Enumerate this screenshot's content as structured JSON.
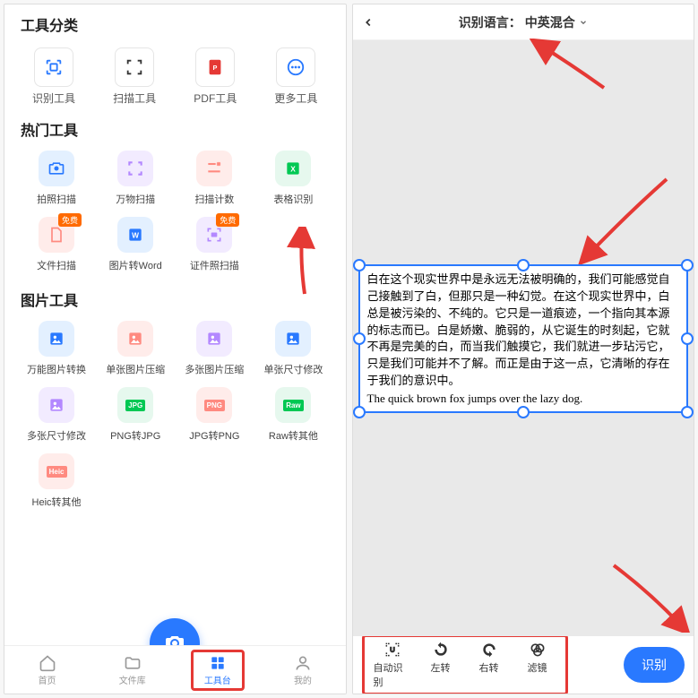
{
  "left": {
    "sections": {
      "categories_title": "工具分类",
      "hot_title": "热门工具",
      "img_title": "图片工具"
    },
    "categories": [
      {
        "label": "识别工具",
        "icon": "scan-frame"
      },
      {
        "label": "扫描工具",
        "icon": "scan-corners"
      },
      {
        "label": "PDF工具",
        "icon": "pdf"
      },
      {
        "label": "更多工具",
        "icon": "more"
      }
    ],
    "hot_tools": [
      {
        "label": "拍照扫描",
        "color": "#2979ff",
        "icon": "camera"
      },
      {
        "label": "万物扫描",
        "color": "#b388ff",
        "icon": "scan"
      },
      {
        "label": "扫描计数",
        "color": "#ff8a80",
        "icon": "count"
      },
      {
        "label": "表格识别",
        "color": "#00c853",
        "icon": "excel"
      },
      {
        "label": "文件扫描",
        "color": "#ff8a80",
        "icon": "file",
        "badge": "免费"
      },
      {
        "label": "图片转Word",
        "color": "#2979ff",
        "icon": "word"
      },
      {
        "label": "证件照扫描",
        "color": "#b388ff",
        "icon": "idcard",
        "badge": "免费"
      }
    ],
    "img_tools": [
      {
        "label": "万能图片转换",
        "color": "#2979ff"
      },
      {
        "label": "单张图片压缩",
        "color": "#ff8a80"
      },
      {
        "label": "多张图片压缩",
        "color": "#b388ff"
      },
      {
        "label": "单张尺寸修改",
        "color": "#2979ff"
      },
      {
        "label": "多张尺寸修改",
        "color": "#b388ff"
      },
      {
        "label": "PNG转JPG",
        "color": "#00c853",
        "tag": "JPG"
      },
      {
        "label": "JPG转PNG",
        "color": "#ff8a80",
        "tag": "PNG"
      },
      {
        "label": "Raw转其他",
        "color": "#00c853",
        "tag": "Raw"
      },
      {
        "label": "Heic转其他",
        "color": "#ff8a80",
        "tag": "Heic"
      }
    ],
    "navbar": [
      {
        "label": "首页",
        "icon": "home"
      },
      {
        "label": "文件库",
        "icon": "folder"
      },
      {
        "label": "工具台",
        "icon": "grid",
        "active": true,
        "highlighted": true
      },
      {
        "label": "我的",
        "icon": "user"
      }
    ]
  },
  "right": {
    "header_label": "识别语言：",
    "header_value": "中英混合",
    "text_cn": "白在这个现实世界中是永远无法被明确的，我们可能感觉自己接触到了白，但那只是一种幻觉。在这个现实世界中，白总是被污染的、不纯的。它只是一道痕迹，一个指向其本源的标志而已。白是娇嫩、脆弱的，从它诞生的时刻起，它就不再是完美的白，而当我们触摸它，我们就进一步玷污它，只是我们可能并不了解。而正是由于这一点，它清晰的存在于我们的意识中。",
    "text_en": "The quick brown fox jumps over the lazy dog.",
    "toolbar": [
      {
        "label": "自动识别",
        "icon": "auto"
      },
      {
        "label": "左转",
        "icon": "rotate-left"
      },
      {
        "label": "右转",
        "icon": "rotate-right"
      },
      {
        "label": "滤镜",
        "icon": "filter"
      }
    ],
    "recognize_label": "识别"
  }
}
